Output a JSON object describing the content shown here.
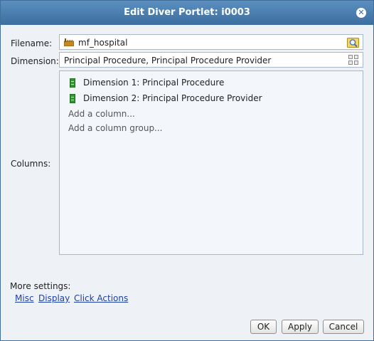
{
  "dialog": {
    "title": "Edit Diver Portlet: i0003",
    "close_icon": "close-icon"
  },
  "form": {
    "filename_label": "Filename:",
    "filename_value": "mf_hospital",
    "filename_icon": "factory-icon",
    "browse_icon": "search-folder-icon",
    "dimension_label": "Dimension:",
    "dimension_value": "Principal Procedure, Principal Procedure Provider",
    "dimension_icon": "grid-icon",
    "columns_label": "Columns:",
    "columns": [
      {
        "label": "Dimension 1: Principal Procedure",
        "icon": "column-icon"
      },
      {
        "label": "Dimension 2: Principal Procedure Provider",
        "icon": "column-icon"
      }
    ],
    "add_column": "Add a column...",
    "add_column_group": "Add a column group..."
  },
  "more_settings": {
    "label": "More settings:",
    "links": [
      "Misc",
      "Display",
      "Click Actions"
    ]
  },
  "buttons": {
    "ok": "OK",
    "apply": "Apply",
    "cancel": "Cancel"
  },
  "colors": {
    "titlebar": "#4a7fb2",
    "body": "#eef2f7",
    "link": "#1b3fa8",
    "column_icon": "#2c9a2c"
  }
}
